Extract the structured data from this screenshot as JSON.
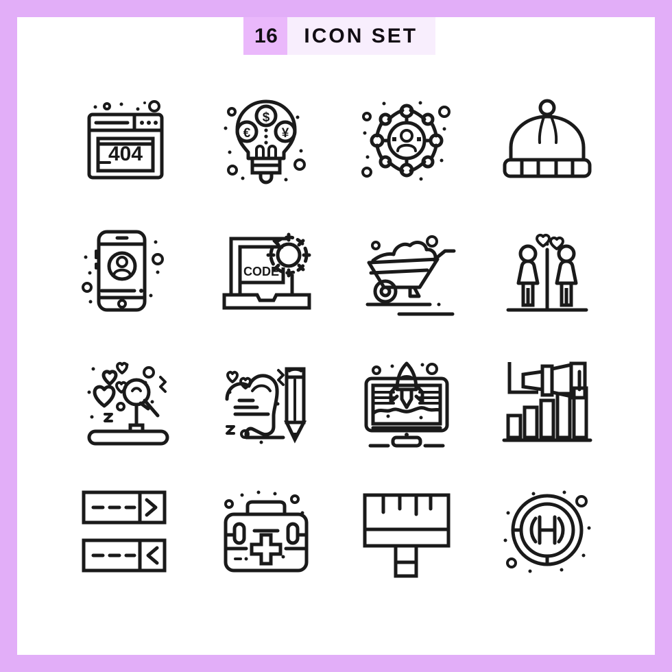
{
  "header": {
    "count": "16",
    "title": "ICON SET"
  },
  "colors": {
    "page_background": "#e2aef8",
    "panel_background": "#ffffff",
    "badge_background": "#eab8fb",
    "title_background": "#f8eefd",
    "icon_stroke": "#1a1a1a",
    "text": "#120d14"
  },
  "grid": {
    "columns": 4,
    "rows": 4,
    "total": 16
  },
  "icons": [
    {
      "index": 1,
      "name": "error-404-browser-window-icon",
      "label": "404 Error Page",
      "row": 1,
      "col": 1,
      "embedded_text": "404"
    },
    {
      "index": 2,
      "name": "money-idea-lightbulb-icon",
      "label": "Financial Idea",
      "row": 1,
      "col": 2,
      "embedded_text": "$ € ¥"
    },
    {
      "index": 3,
      "name": "social-network-user-icon",
      "label": "Social Network",
      "row": 1,
      "col": 3,
      "embedded_text": ""
    },
    {
      "index": 4,
      "name": "winter-beanie-hat-icon",
      "label": "Winter Cap",
      "row": 1,
      "col": 4,
      "embedded_text": ""
    },
    {
      "index": 5,
      "name": "mobile-user-profile-icon",
      "label": "Mobile Profile",
      "row": 2,
      "col": 1,
      "embedded_text": ""
    },
    {
      "index": 6,
      "name": "laptop-code-gear-icon",
      "label": "Coding Setup",
      "row": 2,
      "col": 2,
      "embedded_text": "CODE"
    },
    {
      "index": 7,
      "name": "wheelbarrow-icon",
      "label": "Wheelbarrow",
      "row": 2,
      "col": 3,
      "embedded_text": ""
    },
    {
      "index": 8,
      "name": "couple-hearts-icon",
      "label": "Couple In Love",
      "row": 2,
      "col": 4,
      "embedded_text": ""
    },
    {
      "index": 9,
      "name": "microphone-hearts-icon",
      "label": "Love Song Microphone",
      "row": 3,
      "col": 1,
      "embedded_text": ""
    },
    {
      "index": 10,
      "name": "heart-pencil-note-icon",
      "label": "Love Letter",
      "row": 3,
      "col": 2,
      "embedded_text": ""
    },
    {
      "index": 11,
      "name": "monitor-rocket-launch-icon",
      "label": "Startup Launch",
      "row": 3,
      "col": 3,
      "embedded_text": ""
    },
    {
      "index": 12,
      "name": "telescope-bar-chart-icon",
      "label": "Business Vision",
      "row": 3,
      "col": 4,
      "embedded_text": ""
    },
    {
      "index": 13,
      "name": "data-transfer-arrows-icon",
      "label": "Data Transfer",
      "row": 4,
      "col": 1,
      "embedded_text": "> <"
    },
    {
      "index": 14,
      "name": "first-aid-kit-icon",
      "label": "First Aid Kit",
      "row": 4,
      "col": 2,
      "embedded_text": ""
    },
    {
      "index": 15,
      "name": "ruler-measure-icon",
      "label": "Ruler",
      "row": 4,
      "col": 3,
      "embedded_text": ""
    },
    {
      "index": 16,
      "name": "helipad-h-icon",
      "label": "Helipad",
      "row": 4,
      "col": 4,
      "embedded_text": "H"
    }
  ]
}
